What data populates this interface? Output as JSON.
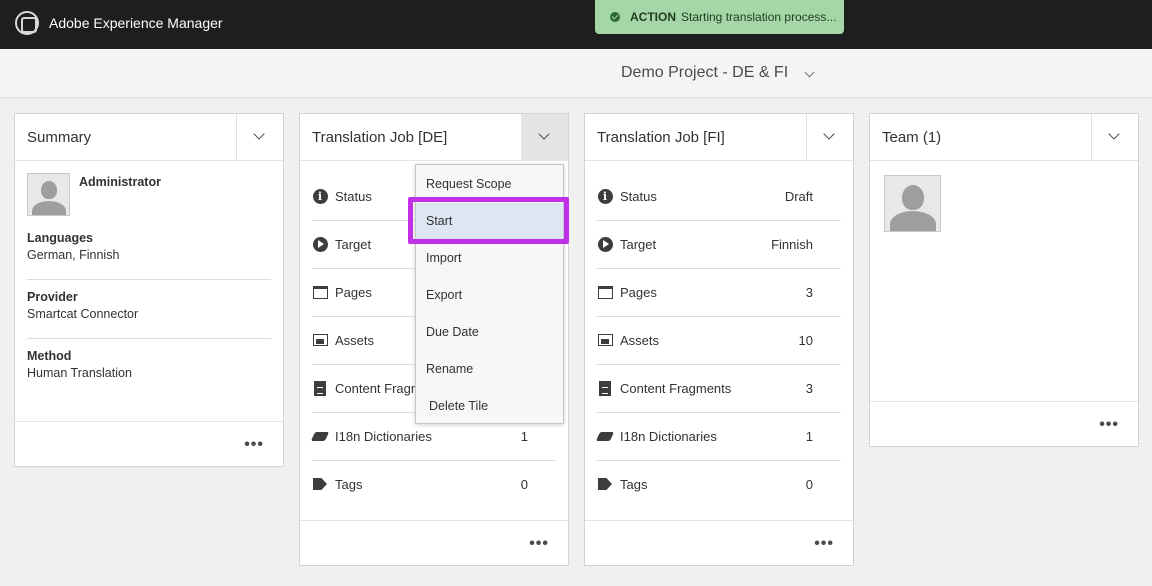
{
  "app": {
    "title": "Adobe Experience Manager",
    "logo_icon": "adobe-logo-icon"
  },
  "toast": {
    "label": "ACTION",
    "message": "Starting translation process..."
  },
  "project": {
    "title": "Demo Project - DE & FI"
  },
  "summary": {
    "title": "Summary",
    "user": "Administrator",
    "languages_label": "Languages",
    "languages_value": "German, Finnish",
    "provider_label": "Provider",
    "provider_value": "Smartcat Connector",
    "method_label": "Method",
    "method_value": "Human Translation",
    "more": "•••"
  },
  "job_de": {
    "title": "Translation Job [DE]",
    "rows": [
      {
        "label": "Status",
        "value": ""
      },
      {
        "label": "Target",
        "value": ""
      },
      {
        "label": "Pages",
        "value": ""
      },
      {
        "label": "Assets",
        "value": ""
      },
      {
        "label": "Content Fragments",
        "value": ""
      },
      {
        "label": "I18n Dictionaries",
        "value": "1"
      },
      {
        "label": "Tags",
        "value": "0"
      }
    ],
    "more": "•••"
  },
  "job_fi": {
    "title": "Translation Job [FI]",
    "rows": [
      {
        "label": "Status",
        "value": "Draft"
      },
      {
        "label": "Target",
        "value": "Finnish"
      },
      {
        "label": "Pages",
        "value": "3"
      },
      {
        "label": "Assets",
        "value": "10"
      },
      {
        "label": "Content Fragments",
        "value": "3"
      },
      {
        "label": "I18n Dictionaries",
        "value": "1"
      },
      {
        "label": "Tags",
        "value": "0"
      }
    ],
    "more": "•••"
  },
  "team": {
    "title": "Team (1)",
    "more": "•••"
  },
  "menu": {
    "items": [
      "Request Scope",
      "Start",
      "Import",
      "Export",
      "Due Date",
      "Rename",
      "Delete Tile"
    ],
    "highlighted": "Start"
  },
  "colors": {
    "toast_bg": "#a5d6a7",
    "highlight_border": "#c030e6",
    "topbar": "#1e1e1e"
  }
}
